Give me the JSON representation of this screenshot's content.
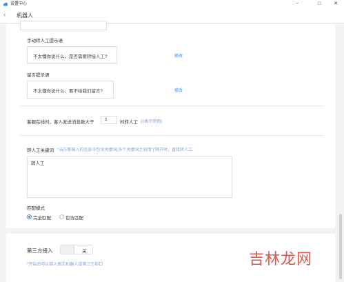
{
  "window": {
    "title": "设置中心",
    "controls": {
      "minimize": "−",
      "maximize": "□",
      "close": "✕"
    }
  },
  "navbar": {
    "back_icon": "‹",
    "title": "机器人"
  },
  "manual_transfer": {
    "label": "手动转人工提示语",
    "value": "不太懂你说什么，是否需要转接人工?",
    "edit": "修改"
  },
  "leave_message": {
    "label": "留言提示语",
    "value": "不太懂你说什么，要不给我们留言?",
    "edit": "修改"
  },
  "auto_transfer": {
    "prefix": "客服在线时，客人发送消息数大于",
    "count": "1",
    "suffix": "时转人工",
    "hint": "(0表示禁用)"
  },
  "keywords": {
    "label": "转人工关键词",
    "hint": "*当访客输入的信息中包含关键词(多个关键词之间用\"|\"隔开时，直接转人工",
    "value": "转人工"
  },
  "match_mode": {
    "label": "匹配模式",
    "options": [
      {
        "label": "完全匹配",
        "selected": true
      },
      {
        "label": "包含匹配",
        "selected": false
      }
    ]
  },
  "third_party": {
    "label": "第三方接入",
    "toggle_text": "关",
    "hint": "*开启后可以接入图灵机器人或第三方接口"
  },
  "watermark": "吉林龙网",
  "colors": {
    "accent": "#3b8ee8",
    "hint": "#8aa3c8",
    "watermark": "#d33a2c"
  }
}
